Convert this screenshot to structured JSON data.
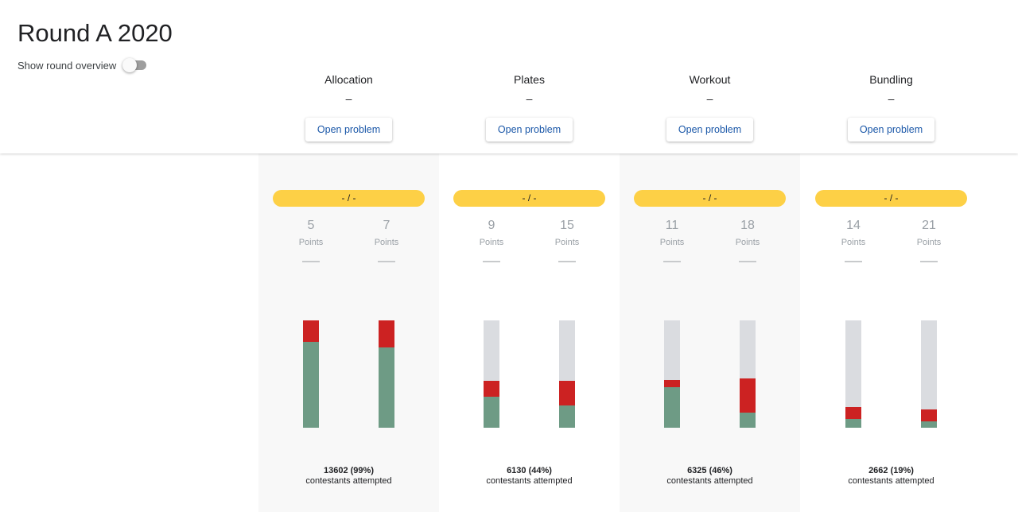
{
  "page": {
    "title": "Round A 2020",
    "overview_toggle": {
      "label": "Show round overview",
      "on": false
    }
  },
  "problems": [
    {
      "name": "Allocation",
      "score": "–",
      "button": "Open problem",
      "pill": "- / -",
      "attempted": "13602 (99%)",
      "attempted_label": "contestants attempted",
      "subtasks": [
        {
          "points": "5",
          "label": "Points",
          "score": "—",
          "correct": 0.8,
          "incorrect": 0.2
        },
        {
          "points": "7",
          "label": "Points",
          "score": "—",
          "correct": 0.75,
          "incorrect": 0.25
        }
      ]
    },
    {
      "name": "Plates",
      "score": "–",
      "button": "Open problem",
      "pill": "- / -",
      "attempted": "6130 (44%)",
      "attempted_label": "contestants attempted",
      "subtasks": [
        {
          "points": "9",
          "label": "Points",
          "score": "—",
          "correct": 0.29,
          "incorrect": 0.15
        },
        {
          "points": "15",
          "label": "Points",
          "score": "—",
          "correct": 0.21,
          "incorrect": 0.23
        }
      ]
    },
    {
      "name": "Workout",
      "score": "–",
      "button": "Open problem",
      "pill": "- / -",
      "attempted": "6325 (46%)",
      "attempted_label": "contestants attempted",
      "subtasks": [
        {
          "points": "11",
          "label": "Points",
          "score": "—",
          "correct": 0.38,
          "incorrect": 0.07
        },
        {
          "points": "18",
          "label": "Points",
          "score": "—",
          "correct": 0.14,
          "incorrect": 0.32
        }
      ]
    },
    {
      "name": "Bundling",
      "score": "–",
      "button": "Open problem",
      "pill": "- / -",
      "attempted": "2662 (19%)",
      "attempted_label": "contestants attempted",
      "subtasks": [
        {
          "points": "14",
          "label": "Points",
          "score": "—",
          "correct": 0.08,
          "incorrect": 0.11
        },
        {
          "points": "21",
          "label": "Points",
          "score": "—",
          "correct": 0.06,
          "incorrect": 0.11
        }
      ]
    }
  ],
  "colors": {
    "correct": "#6e9b85",
    "incorrect": "#cc2222",
    "remaining": "#dadce0",
    "pill": "#fdd046"
  }
}
